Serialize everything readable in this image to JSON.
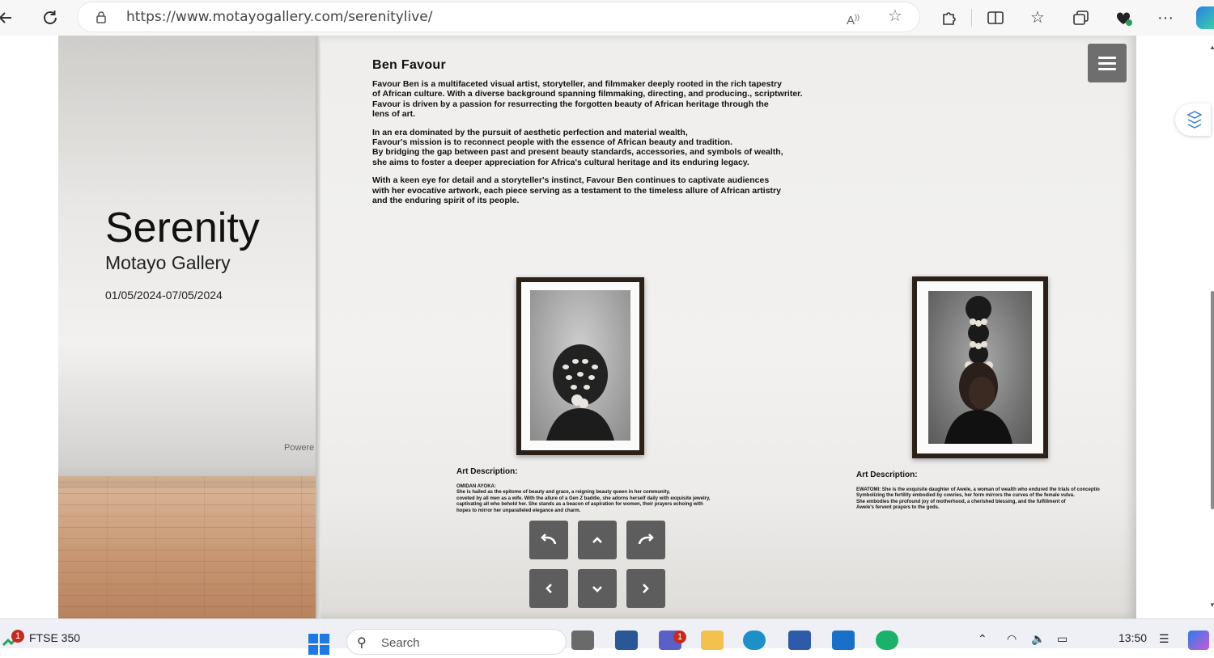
{
  "browser": {
    "url": "https://www.motayogallery.com/serenitylive/",
    "icons": [
      "back-arrow-icon",
      "refresh-icon",
      "lock-icon",
      "read-aloud-icon",
      "favorite-star-icon",
      "extensions-icon",
      "split-screen-icon",
      "favorites-icon",
      "collections-icon",
      "performance-icon",
      "more-icon"
    ]
  },
  "gallery": {
    "title": "Serenity",
    "subtitle": "Motayo Gallery",
    "dates": "01/05/2024-07/05/2024",
    "powered": "Powere",
    "artist_name": "Ben Favour",
    "bio_p1": "Favour Ben is a multifaceted visual artist, storyteller, and filmmaker deeply rooted in the rich tapestry\nof African culture. With a diverse background spanning filmmaking, directing, and producing., scriptwriter.\nFavour is driven by a passion for resurrecting the forgotten beauty of African heritage through the\nlens of art.",
    "bio_p2": "In an era dominated by the pursuit of aesthetic perfection and material wealth,\nFavour's mission is to reconnect people with the essence of African beauty and tradition.\nBy bridging the gap between past and present beauty standards, accessories, and symbols of wealth,\nshe aims to foster a deeper appreciation for Africa's cultural heritage and its enduring legacy.",
    "bio_p3": "With a keen eye for detail and a storyteller's instinct, Favour Ben continues to captivate audiences\nwith her evocative artwork, each piece serving as a testament to the timeless allure of African artistry\nand the enduring spirit of its people.",
    "art1": {
      "heading": "Art Description:",
      "text": "OMIDAN AYOKA:\nShe is hailed as the epitome of beauty and grace, a reigning beauty queen in her community,\ncoveted by all men as a wife. With the allure of a Gen Z baddie, she adorns herself daily with exquisite jewelry,\ncaptivating all who behold her. She stands as a beacon of aspiration for women, their prayers echoing with\nhopes to mirror her unparalleled elegance and charm."
    },
    "art2": {
      "heading": "Art Description:",
      "text": "EWATOMI: She is the exquisite daughter of Awele, a woman of wealth who endured the trials of conceptio\nSymbolizing the fertility embodied by cowries, her form mirrors the curves of the female vulva.\nShe embodies the profound joy of motherhood, a cherished blessing, and the fulfillment of\nAwele's fervent prayers to the gods."
    },
    "controls": [
      "rotate-left",
      "move-up",
      "rotate-right",
      "move-left",
      "move-down",
      "move-right"
    ]
  },
  "taskbar": {
    "stock_label": "FTSE 350",
    "stock_badge": "1",
    "search_placeholder": "Search",
    "teams_badge": "1",
    "time": "13:50"
  },
  "colors": {
    "control_bg": "#5d5d5d",
    "menu_bg": "#6e6e6e",
    "frame": "#2b2119"
  }
}
